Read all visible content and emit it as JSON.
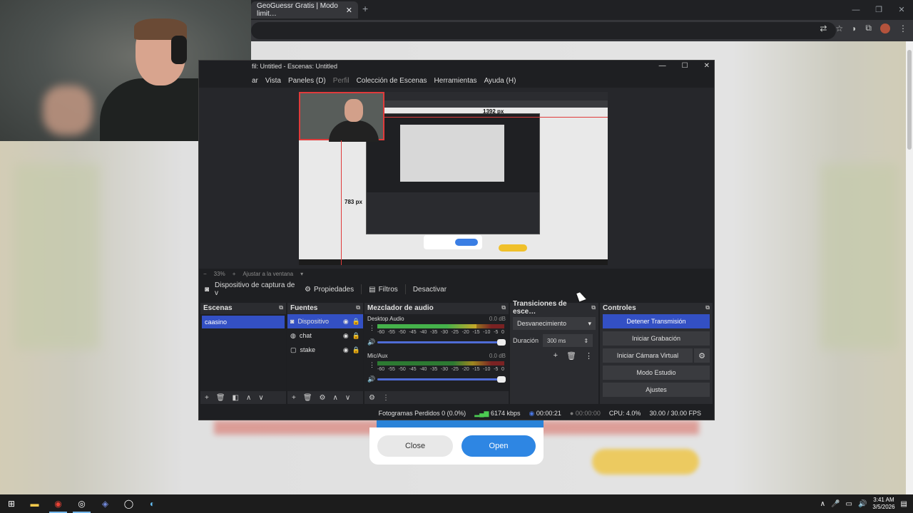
{
  "browser": {
    "tab_title": "GeoGuessr Gratis | Modo limit…",
    "tab_close": "✕",
    "new_tab": "+",
    "window_controls": [
      "—",
      "❐",
      "✕"
    ]
  },
  "obs": {
    "window_title": "fil: Untitled - Escenas: Untitled",
    "menu": [
      "ar",
      "Vista",
      "Paneles (D)",
      "Perfil",
      "Colección de Escenas",
      "Herramientas",
      "Ayuda (H)"
    ],
    "preview": {
      "width_label": "1392 px",
      "height_label": "783 px"
    },
    "zoom": {
      "minus": "−",
      "value": "33%",
      "plus": "+",
      "fit_label": "Ajustar a la ventana"
    },
    "source_toolbar": {
      "source_name": "Dispositivo de captura de v",
      "properties": "Propiedades",
      "filters": "Filtros",
      "deactivate": "Desactivar"
    },
    "scenes": {
      "title": "Escenas",
      "items": [
        "caasino"
      ]
    },
    "sources": {
      "title": "Fuentes",
      "items": [
        {
          "name": "Dispositivo",
          "icon": "camera-icon"
        },
        {
          "name": "chat",
          "icon": "browser-icon"
        },
        {
          "name": "stake",
          "icon": "window-capture-icon"
        }
      ]
    },
    "mixer": {
      "title": "Mezclador de audio",
      "tracks": [
        {
          "name": "Desktop Audio",
          "db": "0.0 dB",
          "level": 0.78
        },
        {
          "name": "Mic/Aux",
          "db": "0.0 dB",
          "level": 0
        }
      ],
      "scale": [
        "-60",
        "-55",
        "-50",
        "-45",
        "-40",
        "-35",
        "-30",
        "-25",
        "-20",
        "-15",
        "-10",
        "-5",
        "0"
      ]
    },
    "transitions": {
      "title": "Transiciones de esce…",
      "selected": "Desvanecimiento",
      "duration_label": "Duración",
      "duration_value": "300 ms"
    },
    "controls": {
      "title": "Controles",
      "stop_stream": "Detener Transmisión",
      "start_recording": "Iniciar Grabación",
      "start_virtual_cam": "Iniciar Cámara Virtual",
      "studio_mode": "Modo Estudio",
      "settings": "Ajustes"
    },
    "status": {
      "dropped_frames": "Fotogramas Perdidos 0 (0.0%)",
      "bitrate": "6174 kbps",
      "stream_time": "00:00:21",
      "rec_time": "00:00:00",
      "cpu": "CPU: 4.0%",
      "fps": "30.00 / 30.00 FPS"
    }
  },
  "dialog": {
    "close": "Close",
    "open": "Open"
  },
  "taskbar": {
    "time": "3:41 AM",
    "date": "3/5/2026"
  },
  "colors": {
    "obs_bg": "#1e1f22",
    "obs_accent": "#3350c4",
    "dialog_open": "#2e86e3"
  }
}
